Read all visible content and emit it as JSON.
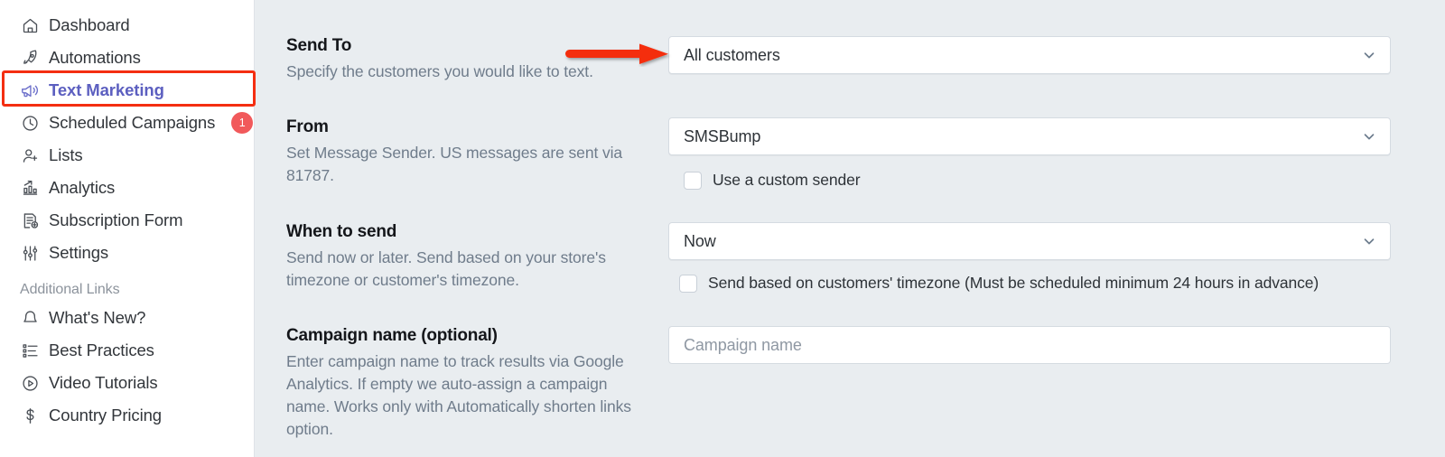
{
  "sidebar": {
    "items": [
      {
        "label": "Dashboard",
        "icon": "home-icon",
        "active": false,
        "badge": null
      },
      {
        "label": "Automations",
        "icon": "rocket-icon",
        "active": false,
        "badge": null
      },
      {
        "label": "Text Marketing",
        "icon": "megaphone-icon",
        "active": true,
        "badge": null
      },
      {
        "label": "Scheduled Campaigns",
        "icon": "clock-icon",
        "active": false,
        "badge": "1"
      },
      {
        "label": "Lists",
        "icon": "add-person-icon",
        "active": false,
        "badge": null
      },
      {
        "label": "Analytics",
        "icon": "bar-chart-icon",
        "active": false,
        "badge": null
      },
      {
        "label": "Subscription Form",
        "icon": "form-add-icon",
        "active": false,
        "badge": null
      },
      {
        "label": "Settings",
        "icon": "sliders-icon",
        "active": false,
        "badge": null
      }
    ],
    "additional_links_heading": "Additional Links",
    "additional_links": [
      {
        "label": "What's New?",
        "icon": "bell-icon"
      },
      {
        "label": "Best Practices",
        "icon": "list-icon"
      },
      {
        "label": "Video Tutorials",
        "icon": "play-circle-icon"
      },
      {
        "label": "Country Pricing",
        "icon": "dollar-icon"
      }
    ],
    "active_highlight_color": "#f42e11",
    "active_text_color": "#5c5fc0",
    "badge_color": "#f1595b"
  },
  "form": {
    "send_to": {
      "title": "Send To",
      "help": "Specify the customers you would like to text.",
      "value": "All customers"
    },
    "from": {
      "title": "From",
      "help": "Set Message Sender. US messages are sent via 81787.",
      "value": "SMSBump",
      "checkbox_label": "Use a custom sender",
      "checked": false
    },
    "when_to_send": {
      "title": "When to send",
      "help": "Send now or later. Send based on your store's timezone or customer's timezone.",
      "value": "Now",
      "checkbox_label": "Send based on customers' timezone (Must be scheduled minimum 24 hours in advance)",
      "checked": false
    },
    "campaign_name": {
      "title": "Campaign name (optional)",
      "help": "Enter campaign name to track results via Google Analytics. If empty we auto-assign a campaign name. Works only with Automatically shorten links option.",
      "placeholder": "Campaign name",
      "value": ""
    }
  },
  "annotation": {
    "arrow_color": "#f42e11",
    "arrow_target": "Send To dropdown"
  }
}
